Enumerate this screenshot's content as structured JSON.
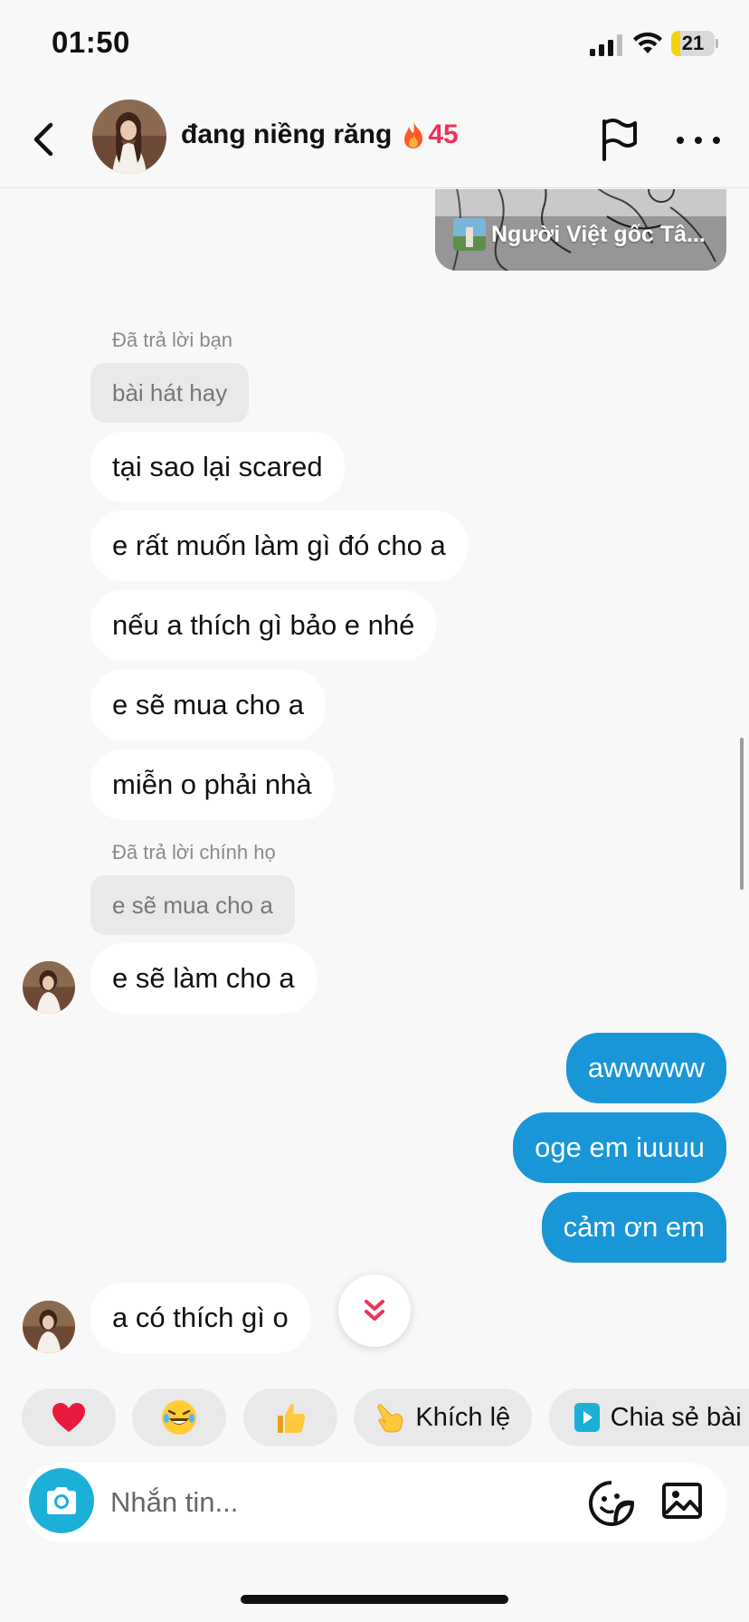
{
  "status_bar": {
    "time": "01:50",
    "battery_level": "21",
    "battery_fraction": 0.21
  },
  "header": {
    "contact_name": "đang niềng răng",
    "streak_count": "45",
    "icons": [
      "back-icon",
      "flag-icon",
      "more-icon"
    ]
  },
  "shared_post": {
    "caption": "Người Việt gốc Tâ..."
  },
  "messages": [
    {
      "side": "in",
      "reply_label": "Đã trả lời bạn",
      "quoted": "bài hát hay"
    },
    {
      "side": "in",
      "text": "tại sao lại scared"
    },
    {
      "side": "in",
      "text": "e rất muốn làm gì đó cho a"
    },
    {
      "side": "in",
      "text": "nếu a thích gì bảo e nhé"
    },
    {
      "side": "in",
      "text": "e sẽ mua cho a"
    },
    {
      "side": "in",
      "text": "miễn o phải nhà"
    },
    {
      "side": "in",
      "reply_label": "Đã trả lời chính họ",
      "quoted": "e sẽ mua cho a"
    },
    {
      "side": "in",
      "text": "e sẽ làm cho a"
    },
    {
      "side": "out",
      "text": "awwwww"
    },
    {
      "side": "out",
      "text": "oge em iuuuu"
    },
    {
      "side": "out",
      "text": "cảm ơn em"
    },
    {
      "side": "in",
      "text": "a có thích gì o"
    }
  ],
  "quick_replies": [
    {
      "icon": "heart-icon"
    },
    {
      "icon": "laughing-emoji-icon"
    },
    {
      "icon": "thumbs-up-icon"
    },
    {
      "icon": "pointing-hand-icon",
      "label": "Khích lệ"
    },
    {
      "icon": "share-video-icon",
      "label": "Chia sẻ bài đăng"
    }
  ],
  "composer": {
    "placeholder": "Nhắn tin..."
  },
  "colors": {
    "outgoing_bubble": "#1896d8",
    "incoming_bubble": "#ffffff",
    "streak": "#f0325a",
    "camera_button": "#1cb0d8",
    "battery": "#f5d20b"
  }
}
